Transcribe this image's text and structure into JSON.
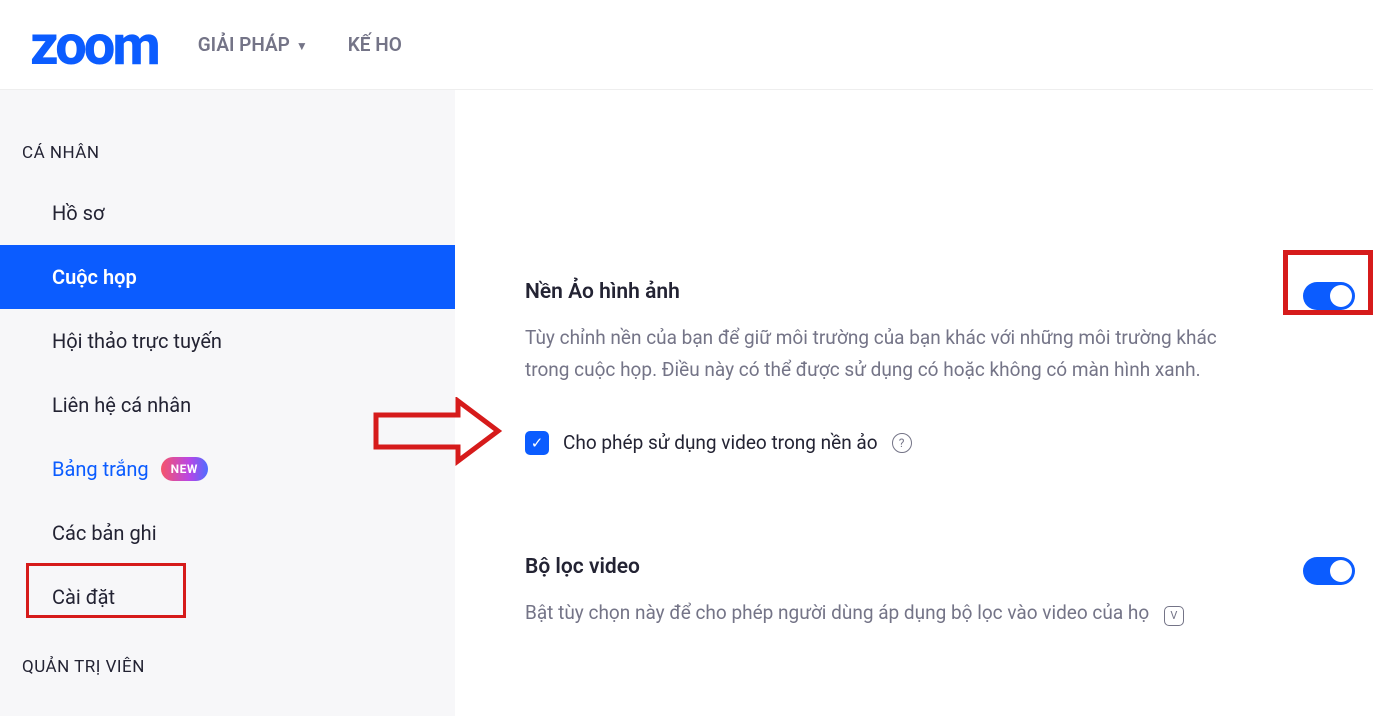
{
  "header": {
    "logo": "zoom",
    "nav": {
      "solutions": "GIẢI PHÁP",
      "plans_partial": "KẾ HO"
    }
  },
  "sidebar": {
    "heading_personal": "CÁ NHÂN",
    "heading_admin": "QUẢN TRỊ VIÊN",
    "items": {
      "profile": "Hồ sơ",
      "meetings": "Cuộc họp",
      "webinars": "Hội thảo trực tuyến",
      "contacts": "Liên hệ cá nhân",
      "whiteboards": "Bảng trắng",
      "recordings": "Các bản ghi",
      "settings": "Cài đặt"
    },
    "new_badge": "NEW"
  },
  "main": {
    "virtual_bg": {
      "title": "Nền Ảo hình ảnh",
      "desc": "Tùy chỉnh nền của bạn để giữ môi trường của bạn khác với những môi trường khác trong cuộc họp. Điều này có thể được sử dụng có hoặc không có màn hình xanh.",
      "checkbox_label": "Cho phép sử dụng video trong nền ảo"
    },
    "video_filter": {
      "title": "Bộ lọc video",
      "desc": "Bật tùy chọn này để cho phép người dùng áp dụng bộ lọc vào video của họ",
      "v_label": "V"
    }
  }
}
